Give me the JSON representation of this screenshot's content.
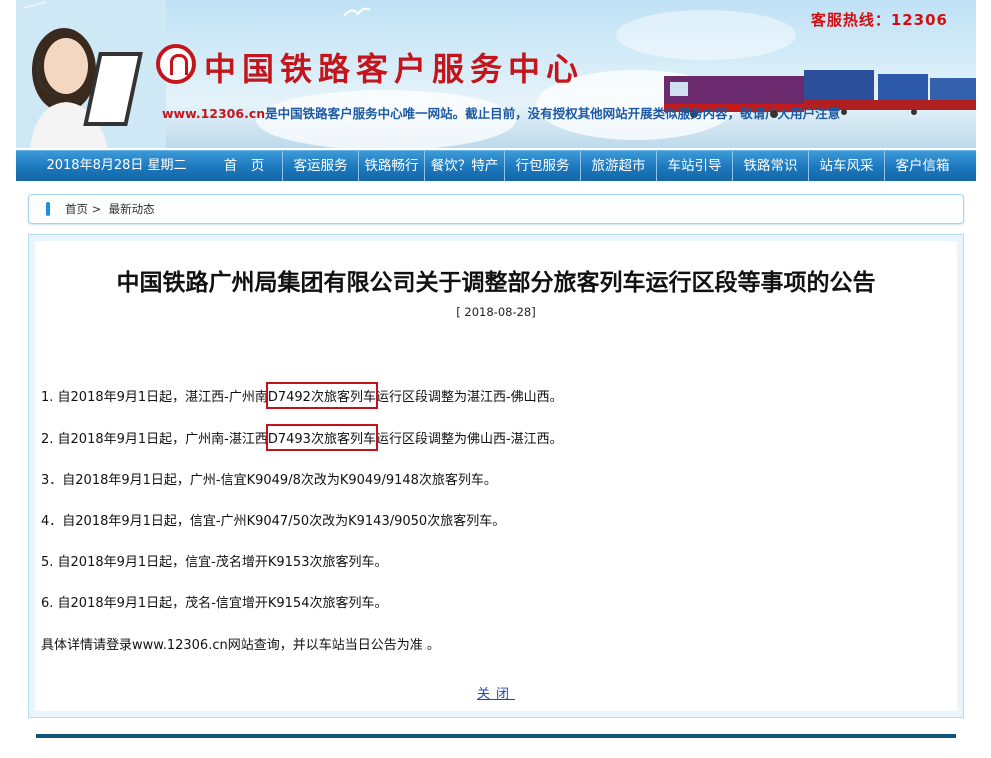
{
  "header": {
    "hotline": "客服热线：12306",
    "site_title": "中国铁路客户服务中心",
    "tagline_url": "www.12306.cn",
    "tagline_text": "是中国铁路客户服务中心唯一网站。截止目前，没有授权其他网站开展类似服务内容，敬请广大用户注意"
  },
  "nav": {
    "date": "2018年8月28日 星期二",
    "items": [
      {
        "label": "首　页"
      },
      {
        "label": "客运服务"
      },
      {
        "label": "铁路畅行"
      },
      {
        "label": "餐饮？特产"
      },
      {
        "label": "行包服务"
      },
      {
        "label": "旅游超市"
      },
      {
        "label": "车站引导"
      },
      {
        "label": "铁路常识"
      },
      {
        "label": "站车风采"
      },
      {
        "label": "客户信箱"
      }
    ]
  },
  "breadcrumb": {
    "home": "首页",
    "separator": ">",
    "current": "最新动态"
  },
  "article": {
    "title": "中国铁路广州局集团有限公司关于调整部分旅客列车运行区段等事项的公告",
    "date": "[ 2018-08-28]",
    "items": [
      {
        "before": "1. 自2018年9月1日起，湛江西-广州南",
        "highlight": "D7492次旅客列车",
        "after": "运行区段调整为湛江西-佛山西。"
      },
      {
        "before": "2. 自2018年9月1日起，广州南-湛江西",
        "highlight": "D7493次旅客列车",
        "after": "运行区段调整为佛山西-湛江西。"
      },
      {
        "text": "3．自2018年9月1日起，广州-信宜K9049/8次改为K9049/9148次旅客列车。"
      },
      {
        "text": "4．自2018年9月1日起，信宜-广州K9047/50次改为K9143/9050次旅客列车。"
      },
      {
        "text": "5. 自2018年9月1日起，信宜-茂名增开K9153次旅客列车。"
      },
      {
        "text": "6. 自2018年9月1日起，茂名-信宜增开K9154次旅客列车。"
      }
    ],
    "note": "具体详情请登录www.12306.cn网站查询，并以车站当日公告为准 。",
    "close_label": "关闭"
  },
  "colors": {
    "accent_red": "#c3161c",
    "nav_blue": "#1c78bd",
    "link_blue": "#1a48b8"
  }
}
